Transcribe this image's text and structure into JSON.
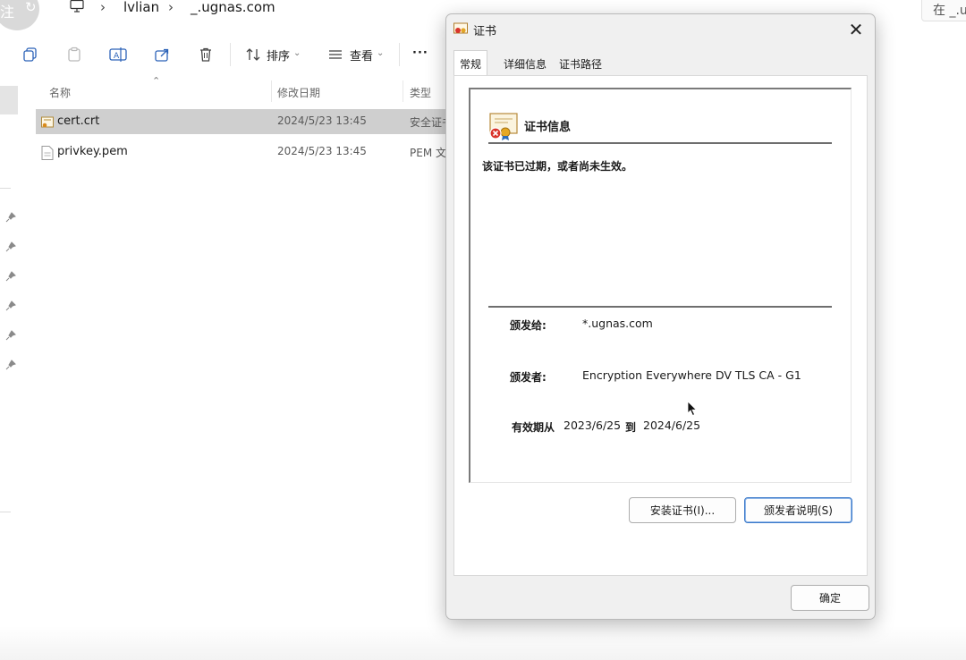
{
  "explorer": {
    "corner_text": "注",
    "breadcrumb": [
      "lvlian",
      "_.ugnas.com"
    ],
    "search_placeholder": "在 _.u",
    "toolbar": {
      "sort_label": "排序",
      "view_label": "查看",
      "more_label": "···"
    },
    "columns": {
      "name": "名称",
      "modified": "修改日期",
      "type": "类型"
    },
    "files": [
      {
        "name": "cert.crt",
        "modified": "2024/5/23 13:45",
        "type": "安全证书",
        "selected": true
      },
      {
        "name": "privkey.pem",
        "modified": "2024/5/23 13:45",
        "type": "PEM 文件",
        "selected": false
      }
    ]
  },
  "dialog": {
    "title": "证书",
    "close_glyph": "✕",
    "tabs": [
      "常规",
      "详细信息",
      "证书路径"
    ],
    "active_tab": 0,
    "heading": "证书信息",
    "warning": "该证书已过期，或者尚未生效。",
    "issued_to_label": "颁发给:",
    "issued_to": "*.ugnas.com",
    "issued_by_label": "颁发者:",
    "issued_by": "Encryption Everywhere DV TLS CA - G1",
    "valid_label": "有效期从",
    "valid_from": "2023/6/25",
    "valid_to_label": "到",
    "valid_to": "2024/6/25",
    "install_button": "安装证书(I)...",
    "issuer_statement_button": "颁发者说明(S)",
    "ok_button": "确定"
  },
  "colors": {
    "accent": "#3a78c9",
    "selected_row": "#cfcfcf",
    "dialog_bg": "#f0f0f0"
  }
}
